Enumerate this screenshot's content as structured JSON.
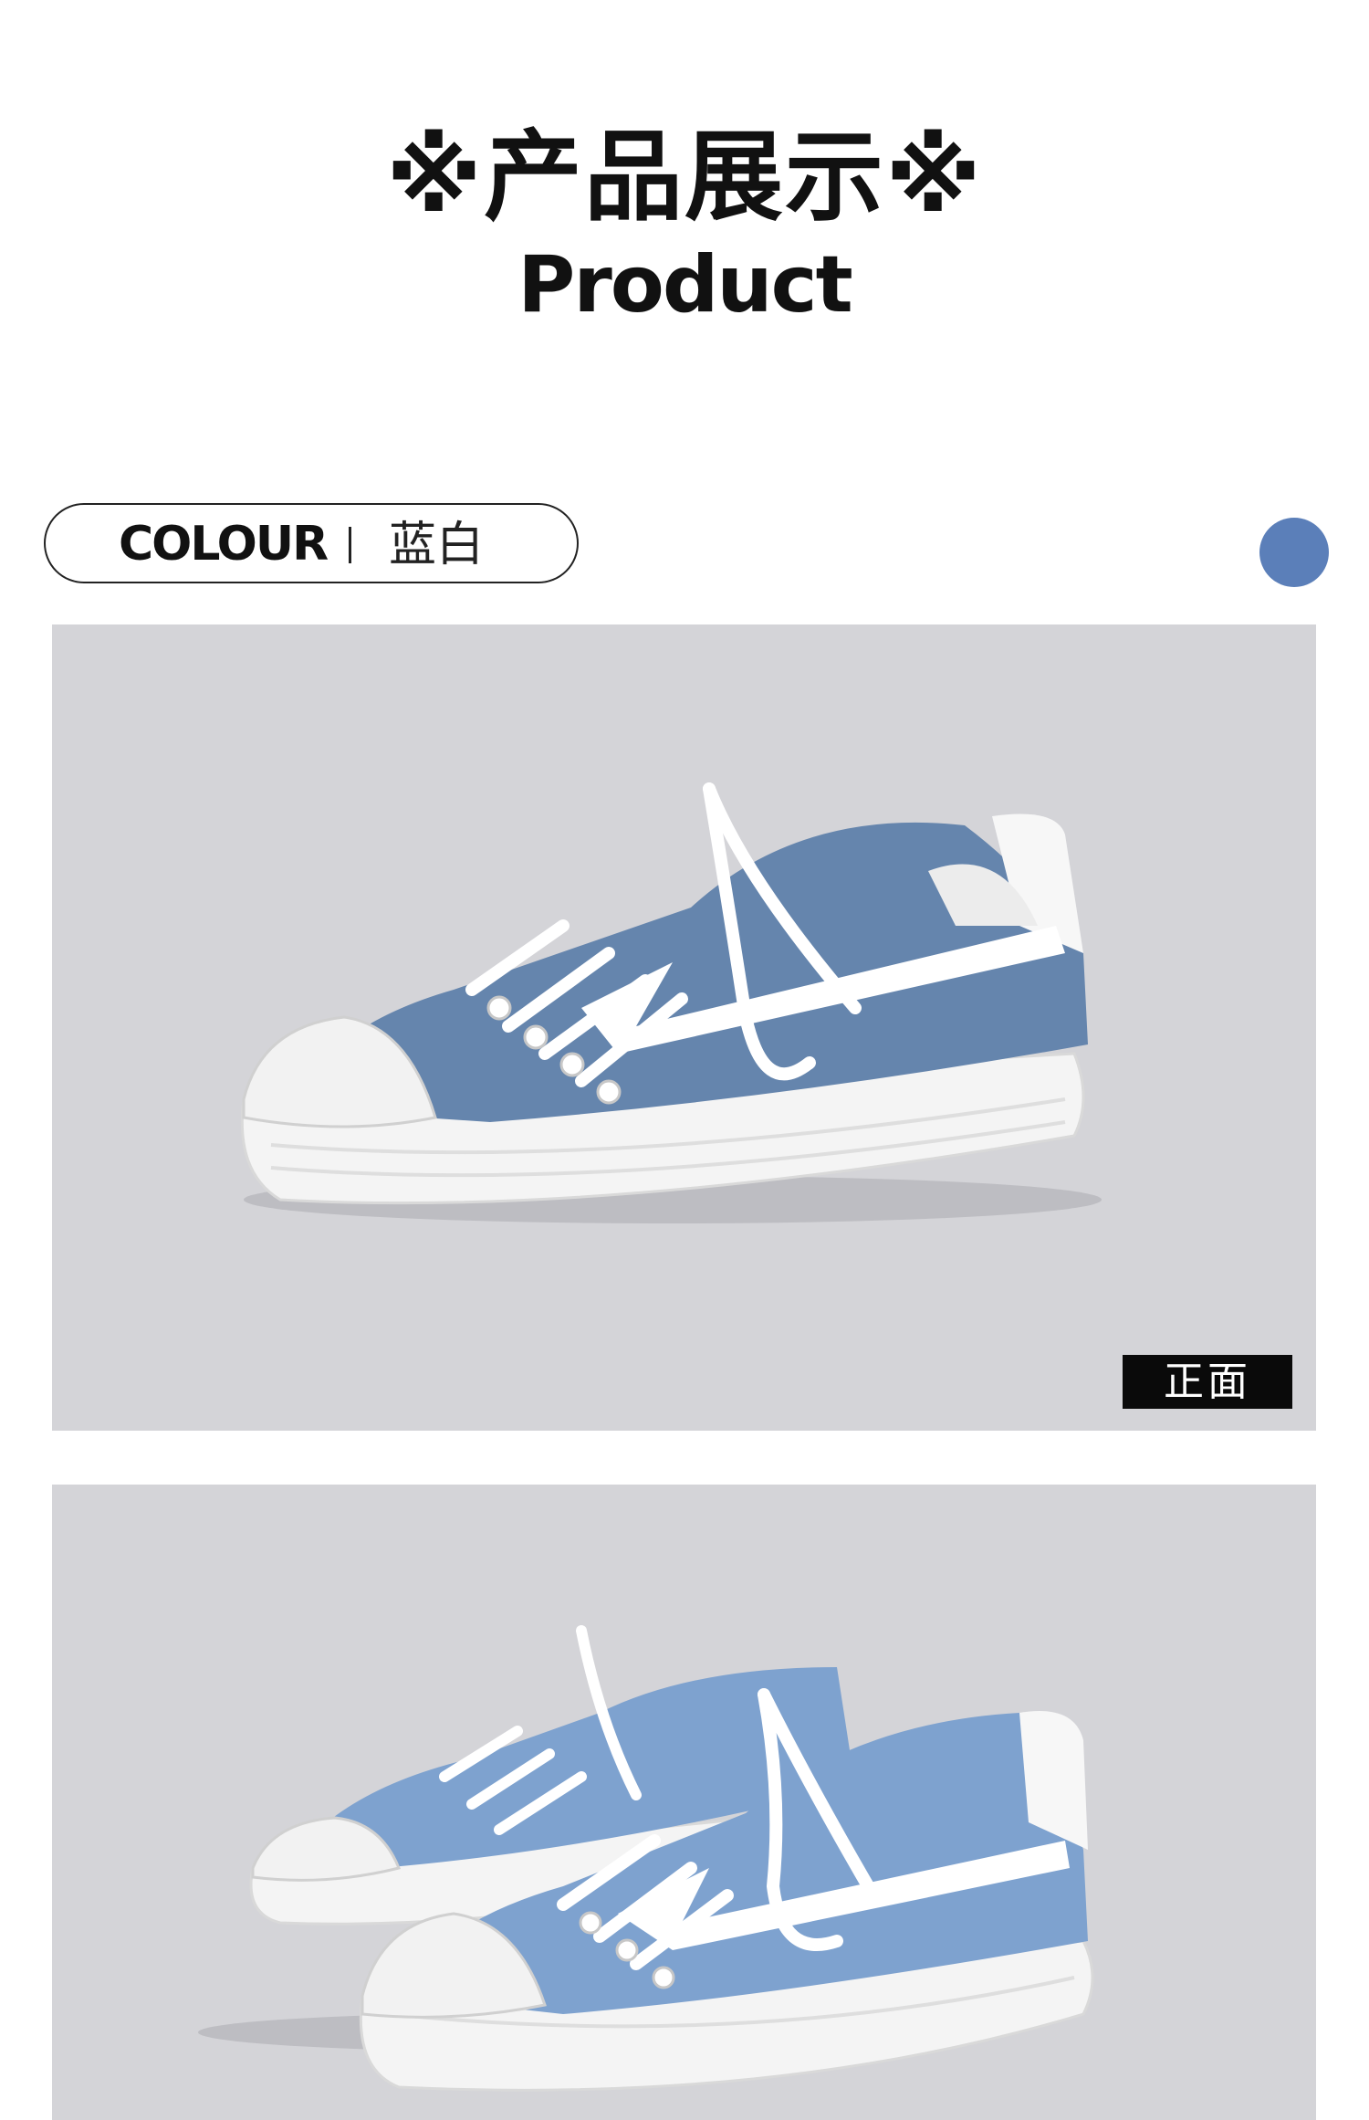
{
  "header": {
    "title_cn": "※产品展示※",
    "title_en": "Product"
  },
  "colour": {
    "label": "COLOUR",
    "value": "蓝白",
    "swatch_color": "#5b7fb9"
  },
  "photos": [
    {
      "view_label": "正面",
      "background": "#d4d4d8"
    },
    {
      "background": "#d4d4d8"
    }
  ],
  "shoe_colors": {
    "canvas": "#6585ad",
    "canvas_light": "#7ea2cf",
    "sole": "#f4f4f4",
    "lace": "#ffffff"
  }
}
